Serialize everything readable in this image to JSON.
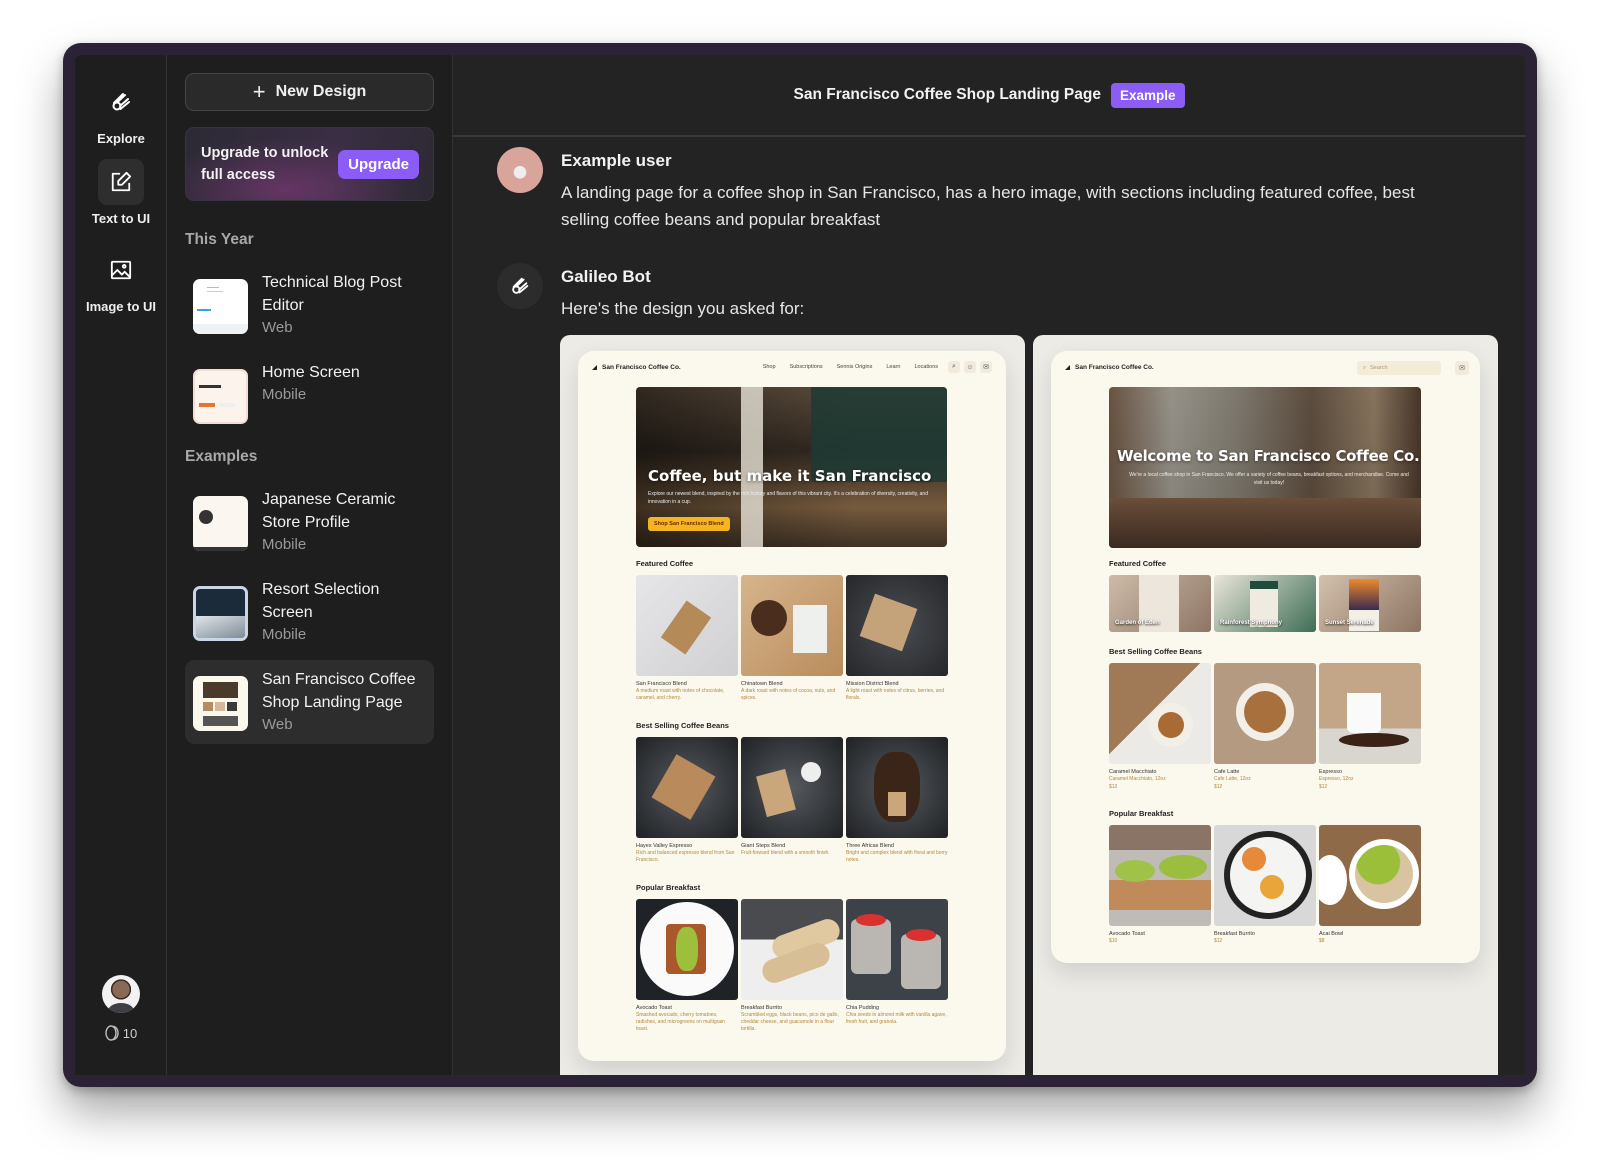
{
  "rail": {
    "items": [
      {
        "label": "Explore",
        "icon": "comet-icon"
      },
      {
        "label": "Text to UI",
        "icon": "edit-icon",
        "active": true
      },
      {
        "label": "Image to UI",
        "icon": "image-icon"
      }
    ],
    "credits": "10"
  },
  "sidebar": {
    "new_design": "New Design",
    "upgrade_text": "Upgrade to unlock full access",
    "upgrade_button": "Upgrade",
    "sections": [
      {
        "title": "This Year",
        "items": [
          {
            "title": "Technical Blog Post Editor",
            "platform": "Web"
          },
          {
            "title": "Home Screen",
            "platform": "Mobile"
          }
        ]
      },
      {
        "title": "Examples",
        "items": [
          {
            "title": "Japanese Ceramic Store Profile",
            "platform": "Mobile"
          },
          {
            "title": "Resort Selection Screen",
            "platform": "Mobile"
          },
          {
            "title": "San Francisco Coffee Shop Landing Page",
            "platform": "Web",
            "selected": true
          }
        ]
      }
    ]
  },
  "header": {
    "title": "San Francisco Coffee Shop Landing Page",
    "badge": "Example"
  },
  "messages": [
    {
      "author": "Example user",
      "text": "A landing page for a coffee shop in San Francisco, has a hero image, with sections including featured coffee, best selling coffee beans and popular breakfast"
    },
    {
      "author": "Galileo Bot",
      "text": "Here's the design you asked for:"
    }
  ],
  "colors": {
    "accent": "#8b5cf6",
    "background": "#1e1e1e",
    "preview_bg": "#fbf8ee",
    "cta": "#f5b521"
  },
  "design1": {
    "brand": "San Francisco Coffee Co.",
    "nav": [
      "Shop",
      "Subscriptions",
      "Sennis Origins",
      "Learn",
      "Locations"
    ],
    "hero_title": "Coffee, but make it San Francisco",
    "hero_text": "Explore our newest blend, inspired by the rich history and flavors of this vibrant city. It's a celebration of diversity, creativity, and innovation in a cup.",
    "hero_cta": "Shop San Francisco Blend",
    "sections": [
      {
        "title": "Featured Coffee",
        "items": [
          {
            "name": "San Francisco Blend",
            "desc": "A medium roast with notes of chocolate, caramel, and cherry."
          },
          {
            "name": "Chinatown Blend",
            "desc": "A dark roast with notes of cocoa, nuts, and spices."
          },
          {
            "name": "Mission District Blend",
            "desc": "A light roast with notes of citrus, berries, and florals."
          }
        ]
      },
      {
        "title": "Best Selling Coffee Beans",
        "items": [
          {
            "name": "Hayes Valley Espresso",
            "desc": "Rich and balanced espresso blend from San Francisco."
          },
          {
            "name": "Giant Steps Blend",
            "desc": "Fruit-forward blend with a smooth finish."
          },
          {
            "name": "Three Africas Blend",
            "desc": "Bright and complex blend with floral and berry notes."
          }
        ]
      },
      {
        "title": "Popular Breakfast",
        "items": [
          {
            "name": "Avocado Toast",
            "desc": "Smashed avocado, cherry tomatoes, radishes, and microgreens on multigrain toast."
          },
          {
            "name": "Breakfast Burrito",
            "desc": "Scrambled eggs, black beans, pico de gallo, cheddar cheese, and guacamole in a flour tortilla."
          },
          {
            "name": "Chia Pudding",
            "desc": "Chia seeds in almond milk with vanilla agave, fresh fruit, and granola."
          }
        ]
      }
    ]
  },
  "design2": {
    "brand": "San Francisco Coffee Co.",
    "search_placeholder": "Search",
    "hero_title": "Welcome to San Francisco Coffee Co.",
    "hero_text": "We're a local coffee shop in San Francisco. We offer a variety of coffee beans, breakfast options, and merchandise. Come and visit us today!",
    "featured": {
      "title": "Featured Coffee",
      "items": [
        "Garden of Eden",
        "Rainforest Symphony",
        "Sunset Serenade"
      ]
    },
    "sections": [
      {
        "title": "Best Selling Coffee Beans",
        "items": [
          {
            "name": "Caramel Macchiato",
            "desc": "Caramel Macchiato, 12oz",
            "price": "$12"
          },
          {
            "name": "Cafe Latte",
            "desc": "Cafe Latte, 12oz",
            "price": "$12"
          },
          {
            "name": "Espresso",
            "desc": "Espresso, 12oz",
            "price": "$12"
          }
        ]
      },
      {
        "title": "Popular Breakfast",
        "items": [
          {
            "name": "Avocado Toast",
            "desc": "",
            "price": "$10"
          },
          {
            "name": "Breakfast Burrito",
            "desc": "",
            "price": "$12"
          },
          {
            "name": "Acai Bowl",
            "desc": "",
            "price": "$8"
          }
        ]
      }
    ]
  }
}
